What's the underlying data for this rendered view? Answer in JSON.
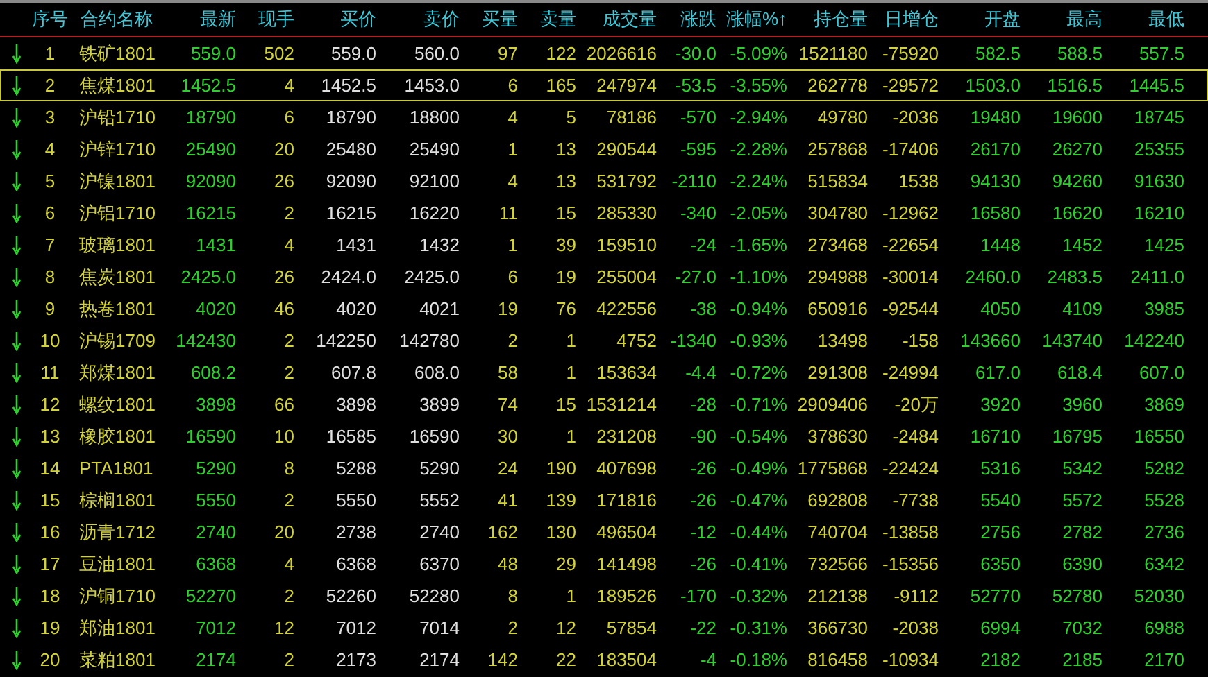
{
  "columns": [
    "序号",
    "合约名称",
    "最新",
    "现手",
    "买价",
    "卖价",
    "买量",
    "卖量",
    "成交量",
    "涨跌",
    "涨幅%↑",
    "持仓量",
    "日增仓",
    "开盘",
    "最高",
    "最低"
  ],
  "rows": [
    {
      "selected": false,
      "cells": [
        "1",
        "铁矿1801",
        "559.0",
        "502",
        "559.0",
        "560.0",
        "97",
        "122",
        "2026616",
        "-30.0",
        "-5.09%",
        "1521180",
        "-75920",
        "582.5",
        "588.5",
        "557.5"
      ]
    },
    {
      "selected": true,
      "cells": [
        "2",
        "焦煤1801",
        "1452.5",
        "4",
        "1452.5",
        "1453.0",
        "6",
        "165",
        "247974",
        "-53.5",
        "-3.55%",
        "262778",
        "-29572",
        "1503.0",
        "1516.5",
        "1445.5"
      ]
    },
    {
      "selected": false,
      "cells": [
        "3",
        "沪铅1710",
        "18790",
        "6",
        "18790",
        "18800",
        "4",
        "5",
        "78186",
        "-570",
        "-2.94%",
        "49780",
        "-2036",
        "19480",
        "19600",
        "18745"
      ]
    },
    {
      "selected": false,
      "cells": [
        "4",
        "沪锌1710",
        "25490",
        "20",
        "25480",
        "25490",
        "1",
        "13",
        "290544",
        "-595",
        "-2.28%",
        "257868",
        "-17406",
        "26170",
        "26270",
        "25355"
      ]
    },
    {
      "selected": false,
      "cells": [
        "5",
        "沪镍1801",
        "92090",
        "26",
        "92090",
        "92100",
        "4",
        "13",
        "531792",
        "-2110",
        "-2.24%",
        "515834",
        "1538",
        "94130",
        "94260",
        "91630"
      ]
    },
    {
      "selected": false,
      "cells": [
        "6",
        "沪铝1710",
        "16215",
        "2",
        "16215",
        "16220",
        "11",
        "15",
        "285330",
        "-340",
        "-2.05%",
        "304780",
        "-12962",
        "16580",
        "16620",
        "16210"
      ]
    },
    {
      "selected": false,
      "cells": [
        "7",
        "玻璃1801",
        "1431",
        "4",
        "1431",
        "1432",
        "1",
        "39",
        "159510",
        "-24",
        "-1.65%",
        "273468",
        "-22654",
        "1448",
        "1452",
        "1425"
      ]
    },
    {
      "selected": false,
      "cells": [
        "8",
        "焦炭1801",
        "2425.0",
        "26",
        "2424.0",
        "2425.0",
        "6",
        "19",
        "255004",
        "-27.0",
        "-1.10%",
        "294988",
        "-30014",
        "2460.0",
        "2483.5",
        "2411.0"
      ]
    },
    {
      "selected": false,
      "cells": [
        "9",
        "热卷1801",
        "4020",
        "46",
        "4020",
        "4021",
        "19",
        "76",
        "422556",
        "-38",
        "-0.94%",
        "650916",
        "-92544",
        "4050",
        "4109",
        "3985"
      ]
    },
    {
      "selected": false,
      "cells": [
        "10",
        "沪锡1709",
        "142430",
        "2",
        "142250",
        "142780",
        "2",
        "1",
        "4752",
        "-1340",
        "-0.93%",
        "13498",
        "-158",
        "143660",
        "143740",
        "142240"
      ]
    },
    {
      "selected": false,
      "cells": [
        "11",
        "郑煤1801",
        "608.2",
        "2",
        "607.8",
        "608.0",
        "58",
        "1",
        "153634",
        "-4.4",
        "-0.72%",
        "291308",
        "-24994",
        "617.0",
        "618.4",
        "607.0"
      ]
    },
    {
      "selected": false,
      "cells": [
        "12",
        "螺纹1801",
        "3898",
        "66",
        "3898",
        "3899",
        "74",
        "15",
        "1531214",
        "-28",
        "-0.71%",
        "2909406",
        "-20万",
        "3920",
        "3960",
        "3869"
      ]
    },
    {
      "selected": false,
      "cells": [
        "13",
        "橡胶1801",
        "16590",
        "10",
        "16585",
        "16590",
        "30",
        "1",
        "231208",
        "-90",
        "-0.54%",
        "378630",
        "-2484",
        "16710",
        "16795",
        "16550"
      ]
    },
    {
      "selected": false,
      "cells": [
        "14",
        "PTA1801",
        "5290",
        "8",
        "5288",
        "5290",
        "24",
        "190",
        "407698",
        "-26",
        "-0.49%",
        "1775868",
        "-22424",
        "5316",
        "5342",
        "5282"
      ]
    },
    {
      "selected": false,
      "cells": [
        "15",
        "棕榈1801",
        "5550",
        "2",
        "5550",
        "5552",
        "41",
        "139",
        "171816",
        "-26",
        "-0.47%",
        "692808",
        "-7738",
        "5540",
        "5572",
        "5528"
      ]
    },
    {
      "selected": false,
      "cells": [
        "16",
        "沥青1712",
        "2740",
        "20",
        "2738",
        "2740",
        "162",
        "130",
        "496504",
        "-12",
        "-0.44%",
        "740704",
        "-13858",
        "2756",
        "2782",
        "2736"
      ]
    },
    {
      "selected": false,
      "cells": [
        "17",
        "豆油1801",
        "6368",
        "4",
        "6368",
        "6370",
        "48",
        "29",
        "141498",
        "-26",
        "-0.41%",
        "732566",
        "-15356",
        "6350",
        "6390",
        "6342"
      ]
    },
    {
      "selected": false,
      "cells": [
        "18",
        "沪铜1710",
        "52270",
        "2",
        "52260",
        "52280",
        "8",
        "1",
        "189526",
        "-170",
        "-0.32%",
        "212138",
        "-9112",
        "52770",
        "52780",
        "52030"
      ]
    },
    {
      "selected": false,
      "cells": [
        "19",
        "郑油1801",
        "7012",
        "12",
        "7012",
        "7014",
        "2",
        "12",
        "57854",
        "-22",
        "-0.31%",
        "366730",
        "-2038",
        "6994",
        "7032",
        "6988"
      ]
    },
    {
      "selected": false,
      "cells": [
        "20",
        "菜粕1801",
        "2174",
        "2",
        "2173",
        "2174",
        "142",
        "22",
        "183504",
        "-4",
        "-0.18%",
        "816458",
        "-10934",
        "2182",
        "2185",
        "2170"
      ]
    }
  ]
}
